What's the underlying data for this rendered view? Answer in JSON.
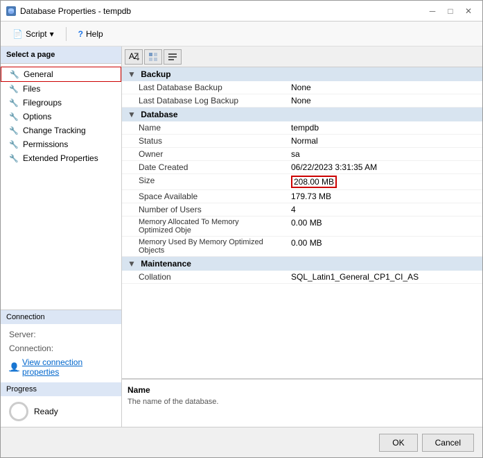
{
  "window": {
    "title": "Database Properties - tempdb",
    "icon": "db-icon"
  },
  "titlebar": {
    "title": "Database Properties - tempdb",
    "minimize": "─",
    "maximize": "□",
    "close": "✕"
  },
  "toolbar": {
    "script_label": "Script",
    "help_label": "Help"
  },
  "sidebar": {
    "select_page_label": "Select a page",
    "items": [
      {
        "label": "General",
        "active": true
      },
      {
        "label": "Files"
      },
      {
        "label": "Filegroups"
      },
      {
        "label": "Options"
      },
      {
        "label": "Change Tracking"
      },
      {
        "label": "Permissions"
      },
      {
        "label": "Extended Properties"
      }
    ],
    "connection_label": "Connection",
    "server_label": "Server:",
    "server_value": "",
    "connection_label2": "Connection:",
    "connection_value": "",
    "view_connection_label": "View connection properties",
    "progress_label": "Progress",
    "ready_label": "Ready"
  },
  "properties": {
    "sections": [
      {
        "name": "Backup",
        "rows": [
          {
            "name": "Last Database Backup",
            "value": "None"
          },
          {
            "name": "Last Database Log Backup",
            "value": "None"
          }
        ]
      },
      {
        "name": "Database",
        "rows": [
          {
            "name": "Name",
            "value": "tempdb",
            "highlight": false
          },
          {
            "name": "Status",
            "value": "Normal",
            "highlight": false
          },
          {
            "name": "Owner",
            "value": "sa",
            "highlight": false
          },
          {
            "name": "Date Created",
            "value": "06/22/2023 3:31:35 AM",
            "highlight": false
          },
          {
            "name": "Size",
            "value": "208.00 MB",
            "highlight": true
          },
          {
            "name": "Space Available",
            "value": "179.73 MB",
            "highlight": false
          },
          {
            "name": "Number of Users",
            "value": "4",
            "highlight": false
          },
          {
            "name": "Memory Allocated To Memory Optimized Obje",
            "value": "0.00 MB",
            "highlight": false
          },
          {
            "name": "Memory Used By Memory Optimized Objects",
            "value": "0.00 MB",
            "highlight": false
          }
        ]
      },
      {
        "name": "Maintenance",
        "rows": [
          {
            "name": "Collation",
            "value": "SQL_Latin1_General_CP1_CI_AS",
            "highlight": false
          }
        ]
      }
    ]
  },
  "description": {
    "title": "Name",
    "text": "The name of the database."
  },
  "footer": {
    "ok_label": "OK",
    "cancel_label": "Cancel"
  }
}
